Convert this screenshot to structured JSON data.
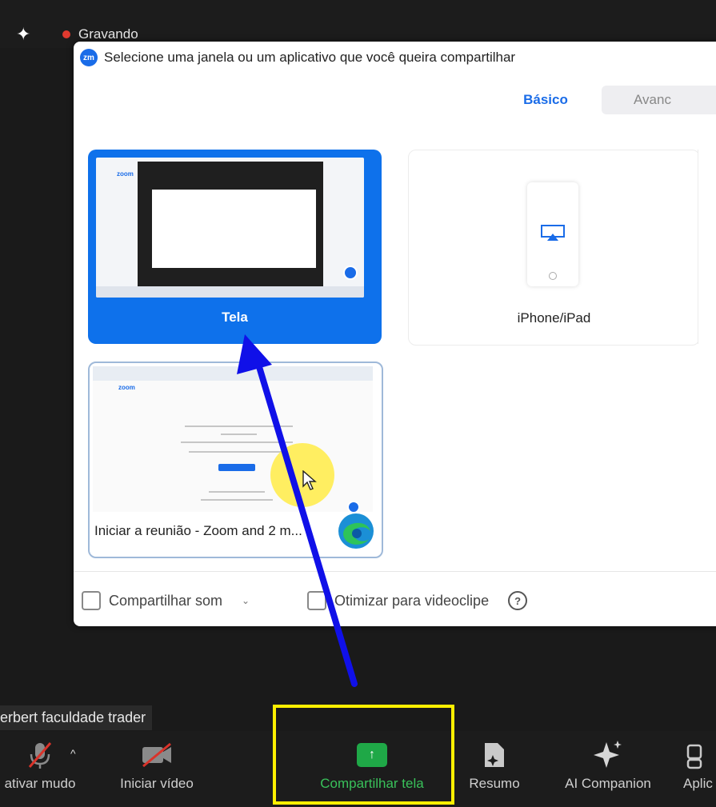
{
  "recording": {
    "label": "Gravando"
  },
  "dialog": {
    "title": "Selecione uma janela ou um aplicativo que você queira compartilhar",
    "logo_text": "zm",
    "tabs": [
      {
        "label": "Básico",
        "active": true
      },
      {
        "label": "Avanc",
        "active": false
      }
    ],
    "cards": {
      "screen": {
        "label": "Tela",
        "selected": true,
        "thumb_text": "zoom"
      },
      "iphone": {
        "label": "iPhone/iPad"
      },
      "browser": {
        "label": "Iniciar a reunião - Zoom and 2 m...",
        "thumb_text": "zoom",
        "app_icon": "edge-icon"
      }
    },
    "options": {
      "share_sound": {
        "label": "Compartilhar som",
        "checked": false
      },
      "optimize_video": {
        "label": "Otimizar para videoclipe",
        "checked": false
      }
    }
  },
  "participant": {
    "name": "erbert faculdade trader"
  },
  "toolbar": {
    "items": [
      {
        "label": "ativar mudo",
        "icon": "mic-muted-icon"
      },
      {
        "label": "Iniciar vídeo",
        "icon": "video-off-icon"
      },
      {
        "label": "Compartilhar tela",
        "icon": "share-screen-icon"
      },
      {
        "label": "Resumo",
        "icon": "summary-icon"
      },
      {
        "label": "AI Companion",
        "icon": "sparkle-icon"
      },
      {
        "label": "Aplic",
        "icon": "apps-icon"
      }
    ]
  },
  "colors": {
    "accent": "#0e71eb",
    "share_green": "#1fa847",
    "highlight": "#ffef00",
    "annotation_arrow": "#1010e8"
  }
}
